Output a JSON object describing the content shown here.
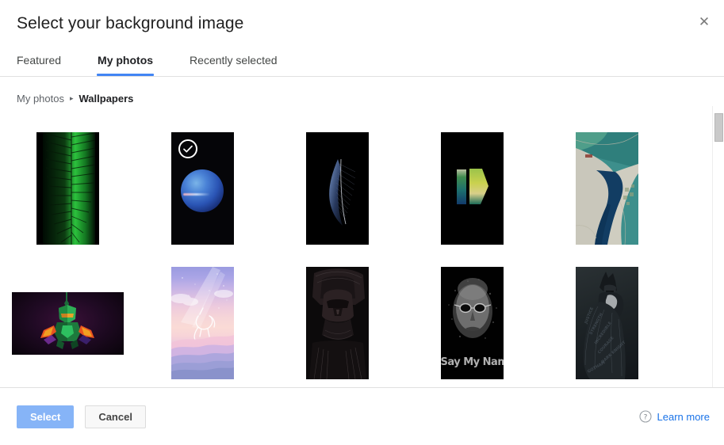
{
  "dialog": {
    "title": "Select your background image",
    "close_label": "✕"
  },
  "tabs": [
    {
      "label": "Featured",
      "active": false
    },
    {
      "label": "My photos",
      "active": true
    },
    {
      "label": "Recently selected",
      "active": false
    }
  ],
  "breadcrumb": {
    "root": "My photos",
    "separator": "▸",
    "current": "Wallpapers"
  },
  "grid": {
    "rows": [
      [
        {
          "name": "green-palm-leaf",
          "orientation": "portrait",
          "selected": false
        },
        {
          "name": "blue-planet-neptune",
          "orientation": "portrait",
          "selected": true
        },
        {
          "name": "abstract-feather",
          "orientation": "portrait",
          "selected": false
        },
        {
          "name": "green-geometric-shapes",
          "orientation": "portrait",
          "selected": false
        },
        {
          "name": "satellite-coastline",
          "orientation": "portrait",
          "selected": false
        }
      ],
      [
        {
          "name": "low-poly-boba-fett",
          "orientation": "landscape",
          "selected": false
        },
        {
          "name": "pastel-unicorn-sky",
          "orientation": "portrait",
          "selected": false
        },
        {
          "name": "darth-vader-helmet",
          "orientation": "portrait",
          "selected": false
        },
        {
          "name": "heisenberg-say-my-name",
          "orientation": "portrait",
          "selected": false,
          "caption": "Say My Name"
        },
        {
          "name": "batman-typography-cape",
          "orientation": "portrait",
          "selected": false
        }
      ]
    ]
  },
  "footer": {
    "select_label": "Select",
    "cancel_label": "Cancel",
    "learn_more_label": "Learn more",
    "help_icon": "question-mark-circle-icon"
  },
  "colors": {
    "accent": "#4285f4",
    "primary_button": "#86b4f7",
    "link": "#1a73e8",
    "divider": "#e0e0e0",
    "text": "#212121",
    "muted_text": "#5f6368"
  }
}
